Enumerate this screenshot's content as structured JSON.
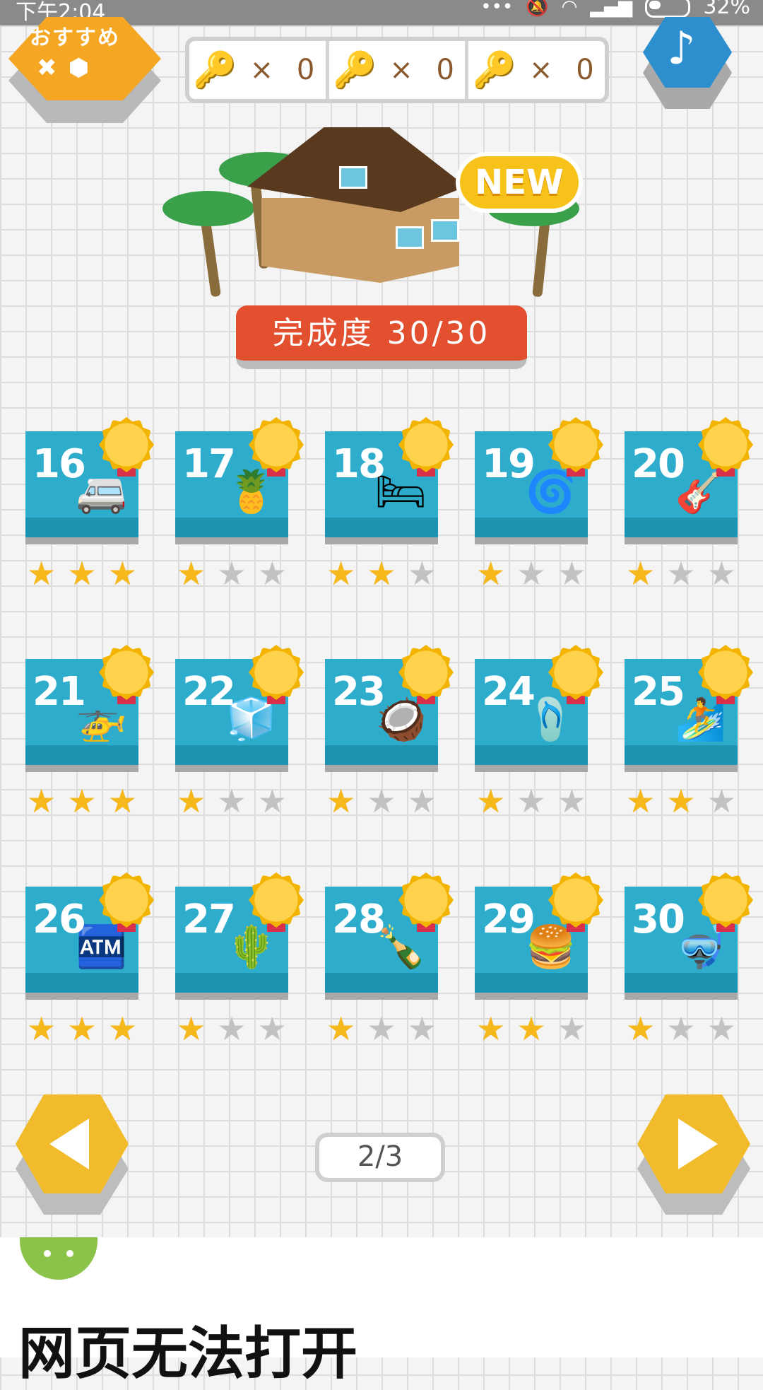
{
  "status_bar": {
    "time": "下午2:04",
    "battery": "32%"
  },
  "top_bar": {
    "recommend_label": "おすすめ",
    "keys": [
      {
        "color": "#7a4a1e",
        "count_text": "× 0"
      },
      {
        "color": "#9b9b9b",
        "count_text": "× 0"
      },
      {
        "color": "#f2c31a",
        "count_text": "× 0"
      }
    ]
  },
  "feature": {
    "new_badge": "NEW",
    "completion_text": "完成度 30/30"
  },
  "levels": [
    {
      "number": "16",
      "stars": 3,
      "icon": "🚐"
    },
    {
      "number": "17",
      "stars": 1,
      "icon": "🍍"
    },
    {
      "number": "18",
      "stars": 2,
      "icon": "🛏"
    },
    {
      "number": "19",
      "stars": 1,
      "icon": "🌀"
    },
    {
      "number": "20",
      "stars": 1,
      "icon": "🎸"
    },
    {
      "number": "21",
      "stars": 3,
      "icon": "🚁"
    },
    {
      "number": "22",
      "stars": 1,
      "icon": "🧊"
    },
    {
      "number": "23",
      "stars": 1,
      "icon": "🥥"
    },
    {
      "number": "24",
      "stars": 1,
      "icon": "🩴"
    },
    {
      "number": "25",
      "stars": 2,
      "icon": "🏄"
    },
    {
      "number": "26",
      "stars": 3,
      "icon": "🏧"
    },
    {
      "number": "27",
      "stars": 1,
      "icon": "🌵"
    },
    {
      "number": "28",
      "stars": 1,
      "icon": "🍾"
    },
    {
      "number": "29",
      "stars": 2,
      "icon": "🍔"
    },
    {
      "number": "30",
      "stars": 1,
      "icon": "🤿"
    }
  ],
  "pager": {
    "text": "2/3",
    "current": 2,
    "total": 3
  },
  "error": {
    "title": "网页无法打开"
  },
  "colors": {
    "card": "#2eaccc",
    "star_on": "#f7b81c",
    "star_off": "#c2c2c2",
    "completion": "#e35030"
  }
}
